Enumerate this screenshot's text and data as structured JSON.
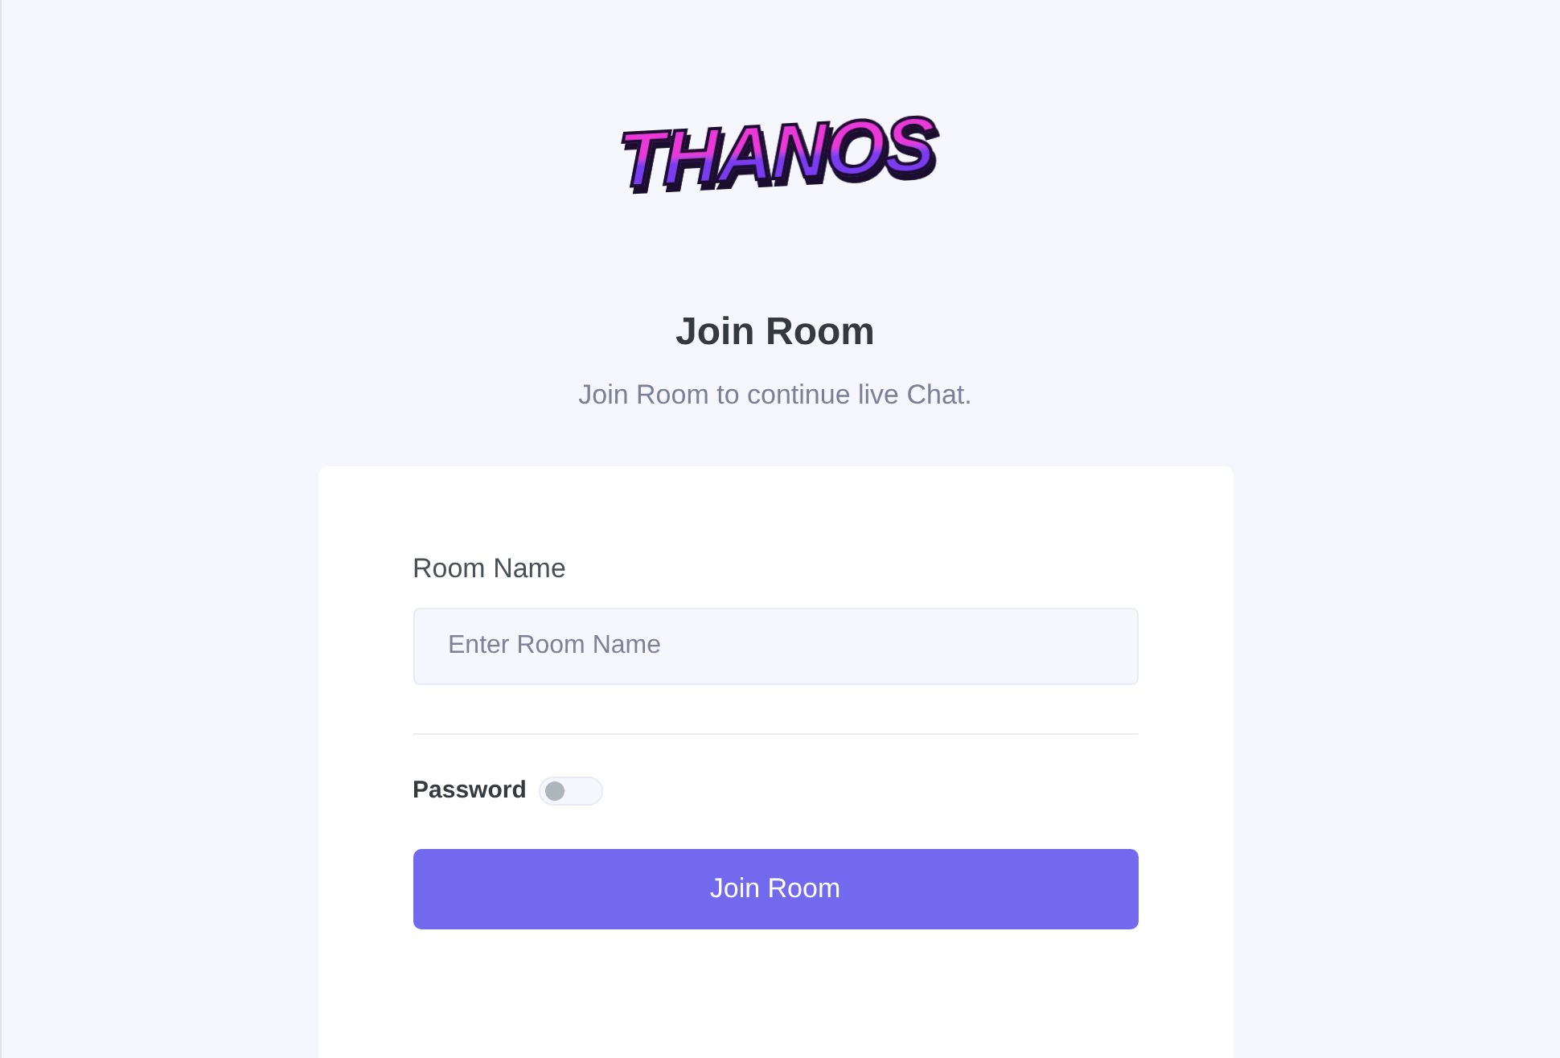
{
  "logo": {
    "text": "THANOS"
  },
  "header": {
    "title": "Join Room",
    "subtitle": "Join Room to continue live Chat."
  },
  "form": {
    "room_name": {
      "label": "Room Name",
      "placeholder": "Enter Room Name"
    },
    "password": {
      "label": "Password",
      "on": false
    },
    "submit": {
      "label": "Join Room"
    }
  }
}
